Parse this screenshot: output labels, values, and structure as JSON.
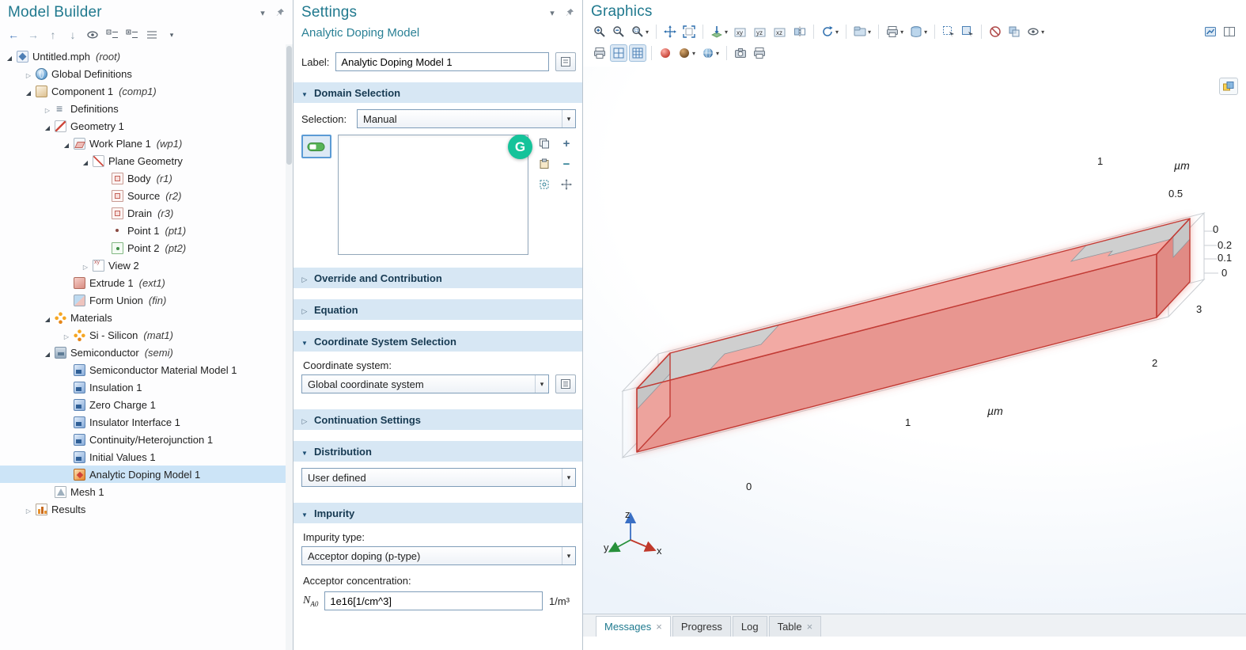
{
  "model_builder": {
    "title": "Model Builder",
    "tree": [
      {
        "label": "Untitled.mph",
        "suffix": "(root)"
      },
      {
        "label": "Global Definitions",
        "suffix": ""
      },
      {
        "label": "Component 1",
        "suffix": "(comp1)"
      },
      {
        "label": "Definitions",
        "suffix": ""
      },
      {
        "label": "Geometry 1",
        "suffix": ""
      },
      {
        "label": "Work Plane 1",
        "suffix": "(wp1)"
      },
      {
        "label": "Plane Geometry",
        "suffix": ""
      },
      {
        "label": "Body",
        "suffix": "(r1)"
      },
      {
        "label": "Source",
        "suffix": "(r2)"
      },
      {
        "label": "Drain",
        "suffix": "(r3)"
      },
      {
        "label": "Point 1",
        "suffix": "(pt1)"
      },
      {
        "label": "Point 2",
        "suffix": "(pt2)"
      },
      {
        "label": "View 2",
        "suffix": ""
      },
      {
        "label": "Extrude 1",
        "suffix": "(ext1)"
      },
      {
        "label": "Form Union",
        "suffix": "(fin)"
      },
      {
        "label": "Materials",
        "suffix": ""
      },
      {
        "label": "Si - Silicon",
        "suffix": "(mat1)"
      },
      {
        "label": "Semiconductor",
        "suffix": "(semi)"
      },
      {
        "label": "Semiconductor Material Model 1",
        "suffix": ""
      },
      {
        "label": "Insulation 1",
        "suffix": ""
      },
      {
        "label": "Zero Charge 1",
        "suffix": ""
      },
      {
        "label": "Insulator Interface 1",
        "suffix": ""
      },
      {
        "label": "Continuity/Heterojunction 1",
        "suffix": ""
      },
      {
        "label": "Initial Values 1",
        "suffix": ""
      },
      {
        "label": "Analytic Doping Model 1",
        "suffix": ""
      },
      {
        "label": "Mesh 1",
        "suffix": ""
      },
      {
        "label": "Results",
        "suffix": ""
      }
    ]
  },
  "settings": {
    "title": "Settings",
    "subtitle": "Analytic Doping Model",
    "label": {
      "caption": "Label:",
      "value": "Analytic Doping Model 1"
    },
    "domain_selection": {
      "header": "Domain Selection",
      "selection_caption": "Selection:",
      "selection_value": "Manual"
    },
    "override": {
      "header": "Override and Contribution"
    },
    "equation": {
      "header": "Equation"
    },
    "coordinate": {
      "header": "Coordinate System Selection",
      "caption": "Coordinate system:",
      "value": "Global coordinate system"
    },
    "continuation": {
      "header": "Continuation Settings"
    },
    "distribution": {
      "header": "Distribution",
      "value": "User defined"
    },
    "impurity": {
      "header": "Impurity",
      "type_caption": "Impurity type:",
      "type_value": "Acceptor doping (p-type)",
      "conc_caption": "Acceptor concentration:",
      "symbol": "N",
      "symbol_sub": "A0",
      "conc_value": "1e16[1/cm^3]",
      "unit": "1/m³"
    }
  },
  "grammarly_badge": "G",
  "graphics": {
    "title": "Graphics",
    "view_buttons": [
      "xy",
      "yz",
      "xz"
    ],
    "ticks": {
      "y_1": "1",
      "y_unit": "µm",
      "y_05": "0.5",
      "y_0": "0",
      "z_02": "0.2",
      "z_01": "0.1",
      "z_0": "0",
      "x_3": "3",
      "x_2": "2",
      "x_1": "1",
      "x_unit": "µm",
      "x_0": "0"
    },
    "triad": {
      "x": "x",
      "y": "y",
      "z": "z"
    },
    "dock_tabs": [
      {
        "label": "Messages"
      },
      {
        "label": "Progress"
      },
      {
        "label": "Log"
      },
      {
        "label": "Table"
      }
    ]
  }
}
